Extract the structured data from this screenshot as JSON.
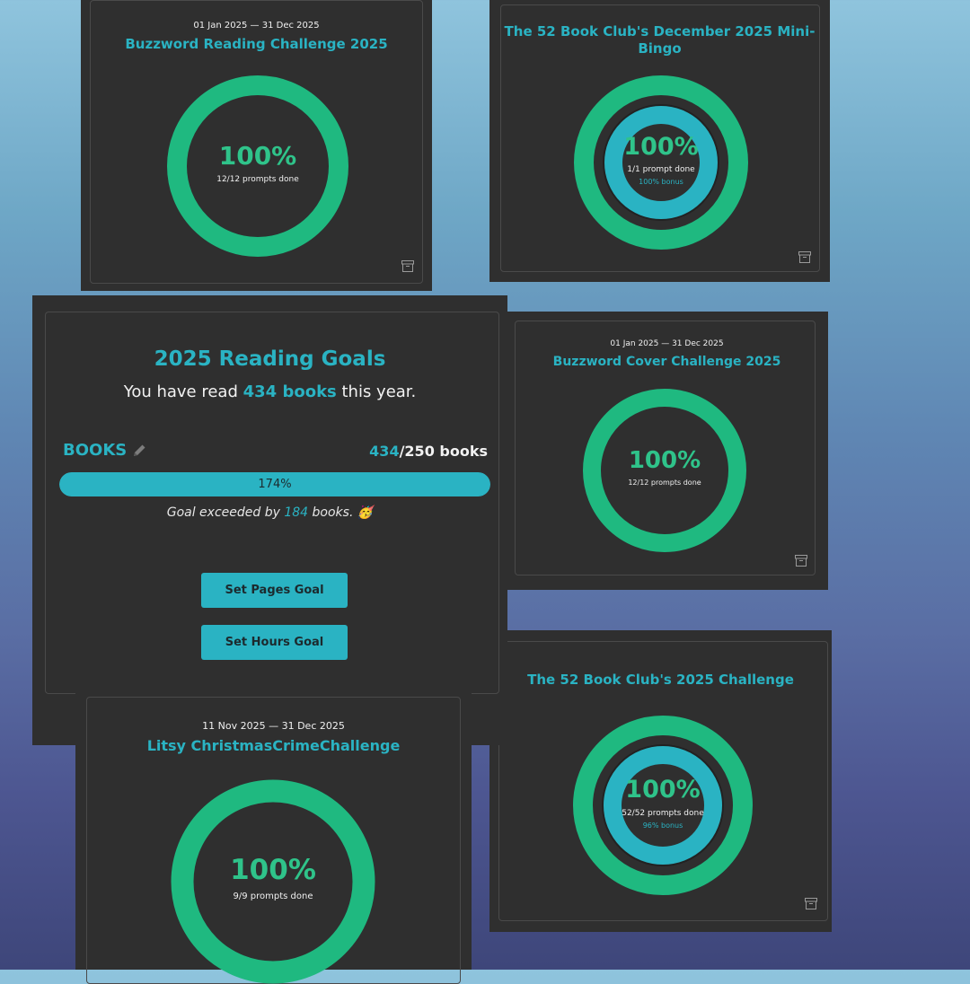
{
  "cards": {
    "buzzword_reading": {
      "dates": "01 Jan 2025 — 31 Dec 2025",
      "title": "Buzzword Reading Challenge 2025",
      "percent": "100%",
      "progress": "12/12 prompts done",
      "progress_fraction": 1.0
    },
    "mini_bingo": {
      "title_line1": "The 52 Book Club's December 2025 Mini-",
      "title_line2": "Bingo",
      "percent": "100%",
      "progress": "1/1 prompt done",
      "bonus": "100% bonus",
      "progress_fraction": 1.0,
      "bonus_fraction": 1.0
    },
    "buzzword_cover": {
      "dates": "01 Jan 2025 — 31 Dec 2025",
      "title": "Buzzword Cover Challenge 2025",
      "percent": "100%",
      "progress": "12/12 prompts done",
      "progress_fraction": 1.0
    },
    "club_2025": {
      "title": "The 52 Book Club's 2025 Challenge",
      "percent": "100%",
      "progress": "52/52 prompts done",
      "bonus": "96% bonus",
      "progress_fraction": 1.0,
      "bonus_fraction": 0.96
    },
    "litsy": {
      "dates": "11 Nov 2025 — 31 Dec 2025",
      "title": "Litsy ChristmasCrimeChallenge",
      "percent": "100%",
      "progress": "9/9 prompts done",
      "progress_fraction": 1.0
    }
  },
  "goals": {
    "title": "2025 Reading Goals",
    "read_prefix": "You have read ",
    "read_count": "434 books",
    "read_suffix": " this year.",
    "label": "BOOKS",
    "current": "434",
    "target": "/250 books",
    "bar_text": "174%",
    "bar_fraction": 1.0,
    "exceeded_prefix": "Goal exceeded by ",
    "exceeded_count": "184",
    "exceeded_suffix": " books. 🥳",
    "pages_button": "Set Pages Goal",
    "hours_button": "Set Hours Goal"
  },
  "colors": {
    "ring_green": "#1fb980",
    "ring_teal": "#2ab3c3",
    "card_bg": "#2f2f2f"
  }
}
